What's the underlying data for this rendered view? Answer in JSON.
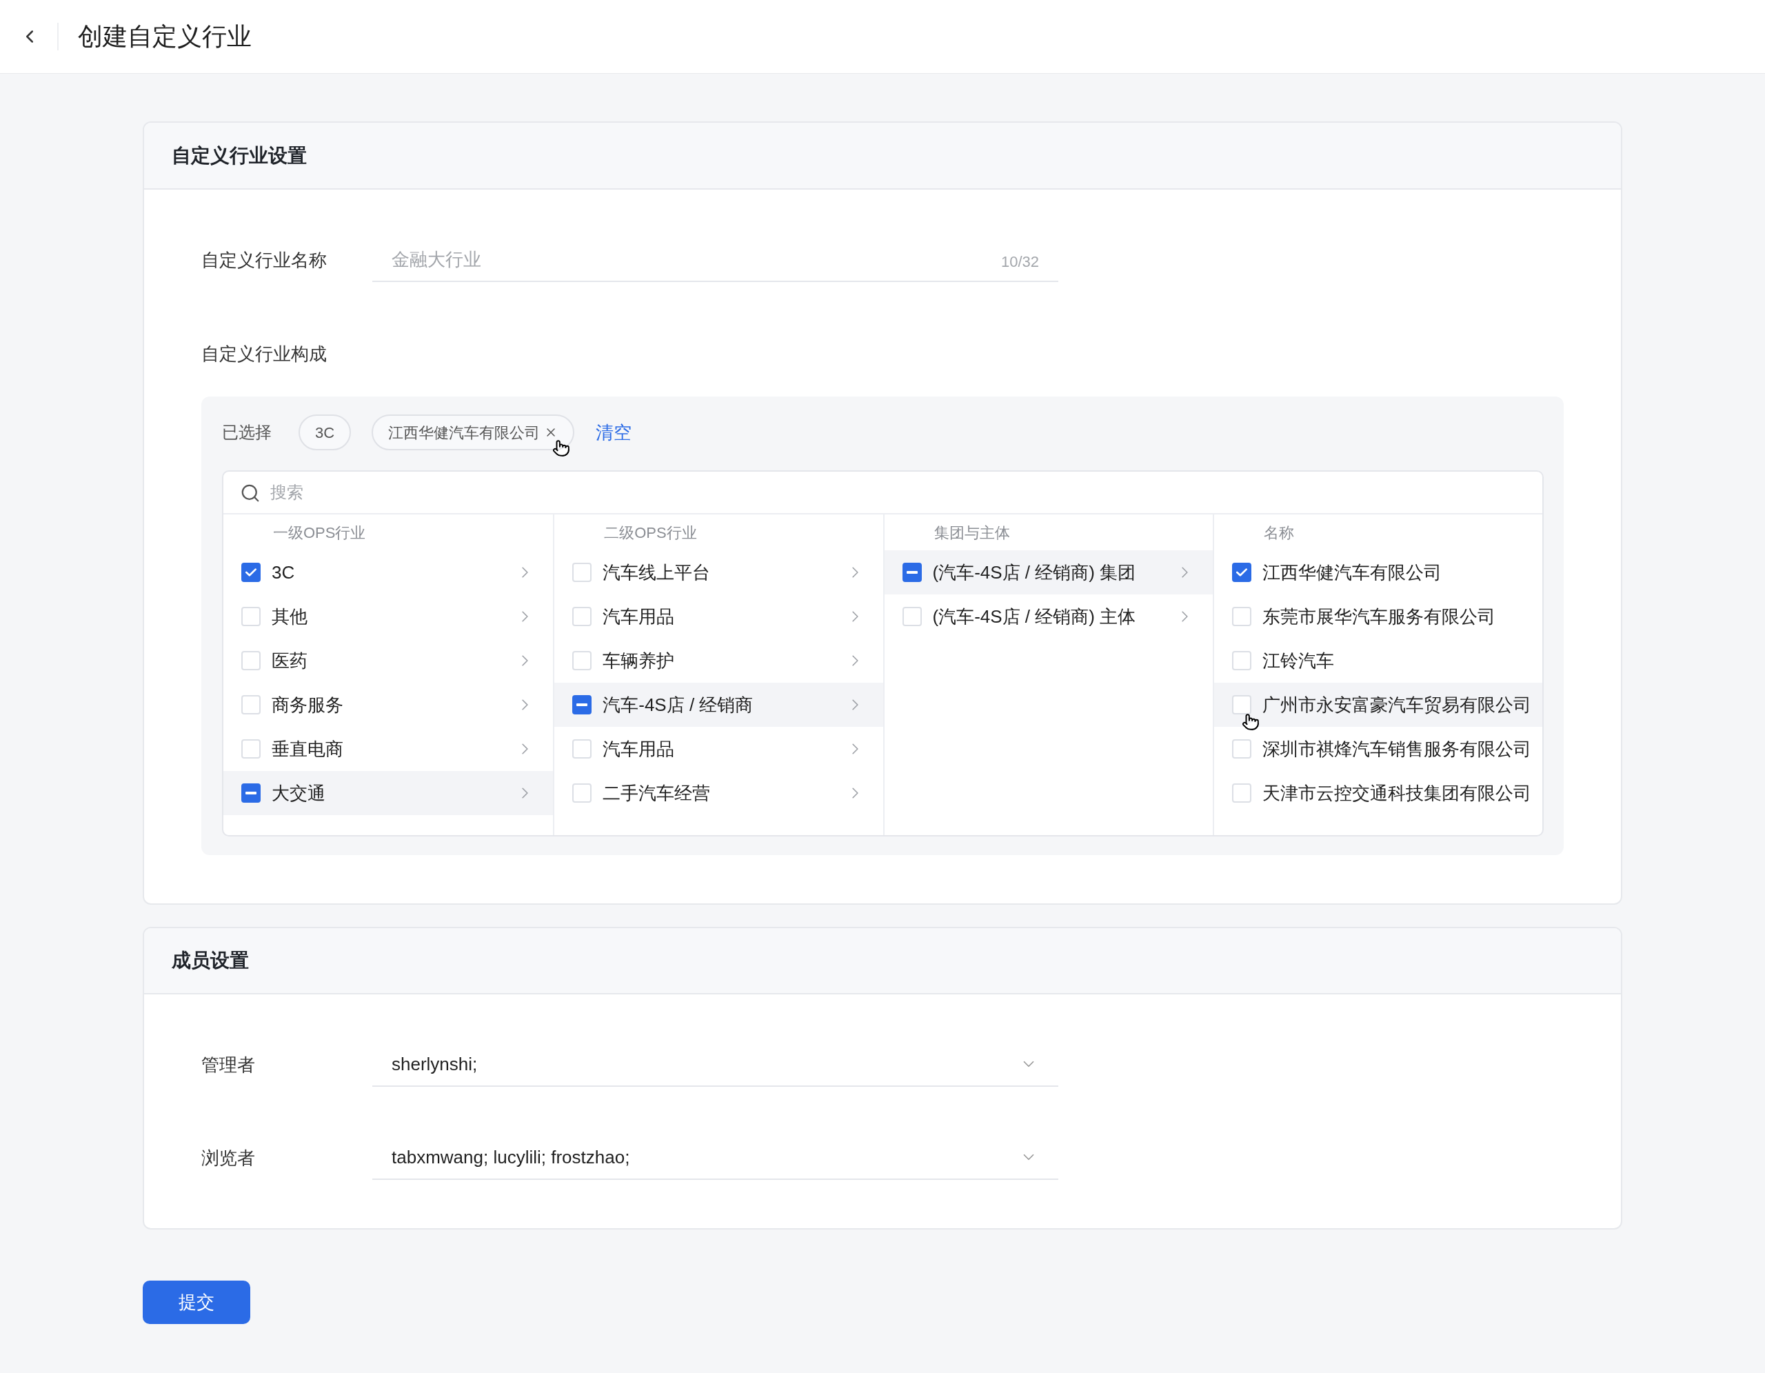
{
  "header": {
    "title": "创建自定义行业"
  },
  "industry_card": {
    "title": "自定义行业设置",
    "name_field": {
      "label": "自定义行业名称",
      "placeholder": "金融大行业",
      "counter": "10/32"
    },
    "composition": {
      "label": "自定义行业构成",
      "selected_label": "已选择",
      "chips": [
        {
          "label": "3C",
          "hovered": false
        },
        {
          "label": "江西华健汽车有限公司",
          "hovered": true
        }
      ],
      "clear_link": "清空",
      "search": {
        "placeholder": "搜索"
      },
      "columns": [
        {
          "header": "一级OPS行业",
          "expandable": true,
          "items": [
            {
              "label": "3C",
              "checked": true,
              "indeterminate": false,
              "highlighted": false,
              "hovered": false
            },
            {
              "label": "其他",
              "checked": false,
              "indeterminate": false,
              "highlighted": false,
              "hovered": false
            },
            {
              "label": "医药",
              "checked": false,
              "indeterminate": false,
              "highlighted": false,
              "hovered": false
            },
            {
              "label": "商务服务",
              "checked": false,
              "indeterminate": false,
              "highlighted": false,
              "hovered": false
            },
            {
              "label": "垂直电商",
              "checked": false,
              "indeterminate": false,
              "highlighted": false,
              "hovered": false
            },
            {
              "label": "大交通",
              "checked": false,
              "indeterminate": true,
              "highlighted": true,
              "hovered": false
            }
          ]
        },
        {
          "header": "二级OPS行业",
          "expandable": true,
          "items": [
            {
              "label": "汽车线上平台",
              "checked": false,
              "indeterminate": false,
              "highlighted": false,
              "hovered": false
            },
            {
              "label": "汽车用品",
              "checked": false,
              "indeterminate": false,
              "highlighted": false,
              "hovered": false
            },
            {
              "label": "车辆养护",
              "checked": false,
              "indeterminate": false,
              "highlighted": false,
              "hovered": false
            },
            {
              "label": "汽车-4S店 / 经销商",
              "checked": false,
              "indeterminate": true,
              "highlighted": true,
              "hovered": false
            },
            {
              "label": "汽车用品",
              "checked": false,
              "indeterminate": false,
              "highlighted": false,
              "hovered": false
            },
            {
              "label": "二手汽车经营",
              "checked": false,
              "indeterminate": false,
              "highlighted": false,
              "hovered": false
            }
          ]
        },
        {
          "header": "集团与主体",
          "expandable": true,
          "items": [
            {
              "label": "(汽车-4S店 / 经销商) 集团",
              "checked": false,
              "indeterminate": true,
              "highlighted": true,
              "hovered": false
            },
            {
              "label": "(汽车-4S店 / 经销商) 主体",
              "checked": false,
              "indeterminate": false,
              "highlighted": false,
              "hovered": false
            }
          ]
        },
        {
          "header": "名称",
          "expandable": false,
          "items": [
            {
              "label": "江西华健汽车有限公司",
              "checked": true,
              "indeterminate": false,
              "highlighted": false,
              "hovered": false
            },
            {
              "label": "东莞市展华汽车服务有限公司",
              "checked": false,
              "indeterminate": false,
              "highlighted": false,
              "hovered": false
            },
            {
              "label": "江铃汽车",
              "checked": false,
              "indeterminate": false,
              "highlighted": false,
              "hovered": false
            },
            {
              "label": "广州市永安富豪汽车贸易有限公司",
              "checked": false,
              "indeterminate": false,
              "highlighted": true,
              "hovered": true
            },
            {
              "label": "深圳市祺烽汽车销售服务有限公司",
              "checked": false,
              "indeterminate": false,
              "highlighted": false,
              "hovered": false
            },
            {
              "label": "天津市云控交通科技集团有限公司",
              "checked": false,
              "indeterminate": false,
              "highlighted": false,
              "hovered": false
            }
          ]
        }
      ]
    }
  },
  "member_card": {
    "title": "成员设置",
    "fields": [
      {
        "label": "管理者",
        "value": "sherlynshi;"
      },
      {
        "label": "浏览者",
        "value": "tabxmwang; lucylili; frostzhao;"
      }
    ]
  },
  "submit_button": "提交"
}
